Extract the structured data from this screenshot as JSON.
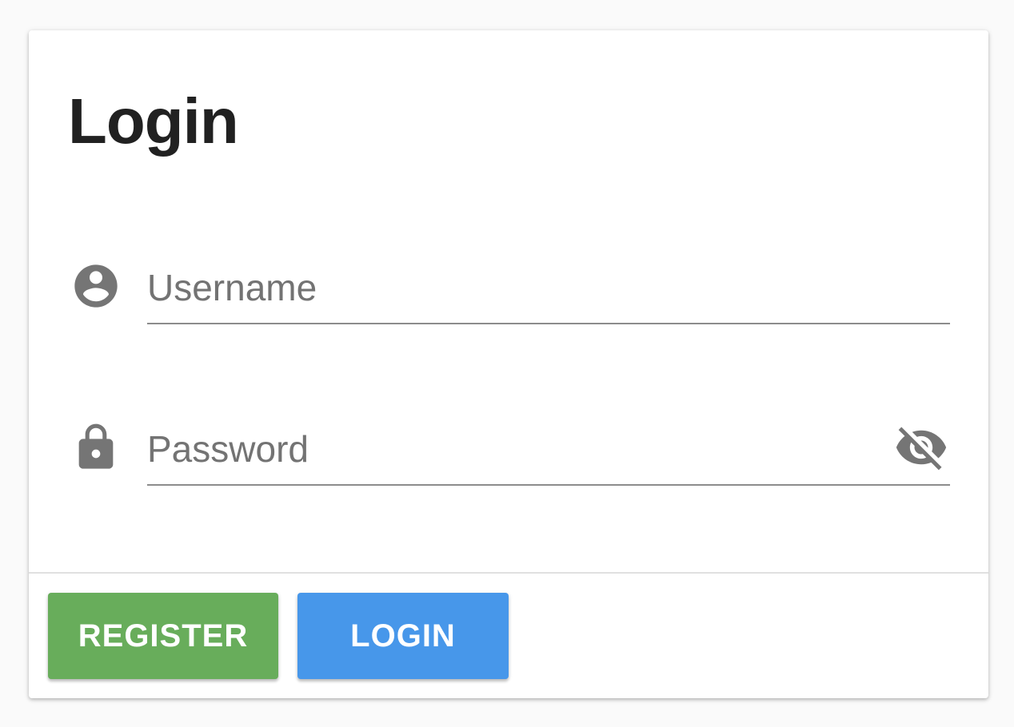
{
  "card": {
    "title": "Login"
  },
  "form": {
    "username": {
      "placeholder": "Username",
      "value": "",
      "icon": "account-circle-icon"
    },
    "password": {
      "placeholder": "Password",
      "value": "",
      "icon": "lock-icon",
      "toggle_icon": "eye-off-icon"
    }
  },
  "actions": {
    "register_label": "REGISTER",
    "login_label": "LOGIN"
  },
  "colors": {
    "register": "#68ad5b",
    "login": "#4797ea",
    "icon": "#757575"
  }
}
